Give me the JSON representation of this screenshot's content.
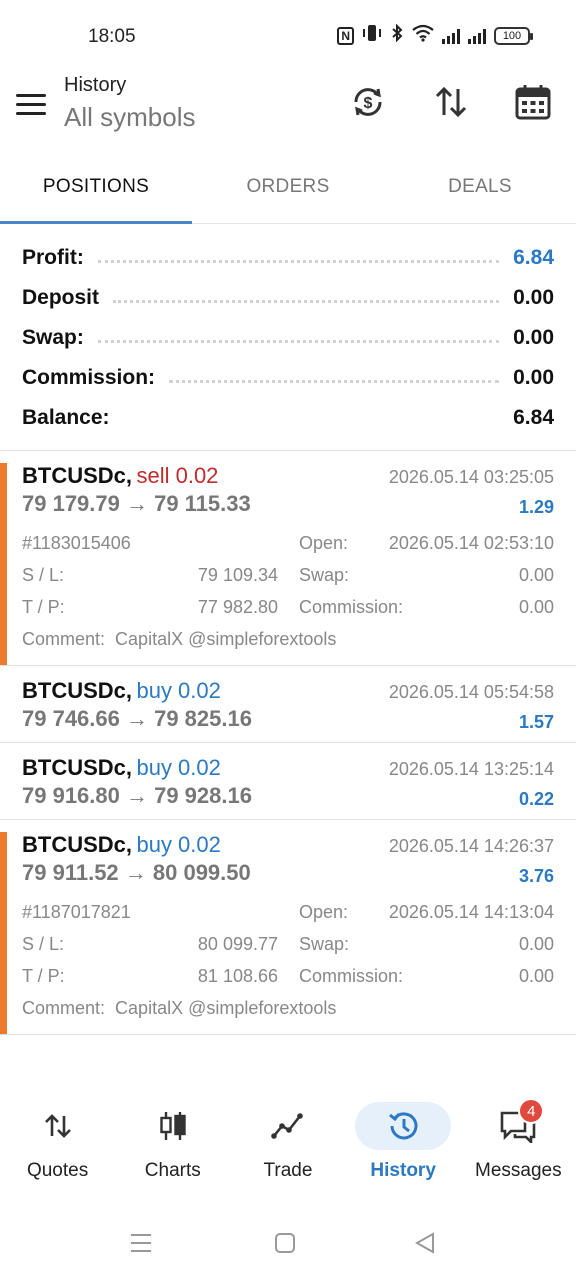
{
  "status_bar": {
    "time": "18:05",
    "battery": "100"
  },
  "header": {
    "title": "History",
    "subtitle": "All symbols"
  },
  "tabs": [
    {
      "label": "POSITIONS",
      "active": true
    },
    {
      "label": "ORDERS",
      "active": false
    },
    {
      "label": "DEALS",
      "active": false
    }
  ],
  "summary": [
    {
      "label": "Profit:",
      "value": "6.84",
      "highlight": true
    },
    {
      "label": "Deposit",
      "value": "0.00",
      "highlight": false
    },
    {
      "label": "Swap:",
      "value": "0.00",
      "highlight": false
    },
    {
      "label": "Commission:",
      "value": "0.00",
      "highlight": false
    },
    {
      "label": "Balance:",
      "value": "6.84",
      "highlight": false
    }
  ],
  "positions": [
    {
      "symbol": "BTCUSDc,",
      "side": "sell 0.02",
      "side_type": "sell",
      "close_time": "2026.05.14 03:25:05",
      "prices": "79 179.79 → 79 115.33",
      "profit": "1.29",
      "expanded": true,
      "ticket": "#1183015406",
      "open_label": "Open:",
      "open_time": "2026.05.14 02:53:10",
      "sl_label": "S / L:",
      "sl": "79 109.34",
      "swap_label": "Swap:",
      "swap": "0.00",
      "tp_label": "T / P:",
      "tp": "77 982.80",
      "commission_label": "Commission:",
      "commission": "0.00",
      "comment_label": "Comment:",
      "comment": "CapitalX @simpleforextools"
    },
    {
      "symbol": "BTCUSDc,",
      "side": "buy 0.02",
      "side_type": "buy",
      "close_time": "2026.05.14 05:54:58",
      "prices": "79 746.66 → 79 825.16",
      "profit": "1.57",
      "expanded": false
    },
    {
      "symbol": "BTCUSDc,",
      "side": "buy 0.02",
      "side_type": "buy",
      "close_time": "2026.05.14 13:25:14",
      "prices": "79 916.80 → 79 928.16",
      "profit": "0.22",
      "expanded": false
    },
    {
      "symbol": "BTCUSDc,",
      "side": "buy 0.02",
      "side_type": "buy",
      "close_time": "2026.05.14 14:26:37",
      "prices": "79 911.52 → 80 099.50",
      "profit": "3.76",
      "expanded": true,
      "ticket": "#1187017821",
      "open_label": "Open:",
      "open_time": "2026.05.14 14:13:04",
      "sl_label": "S / L:",
      "sl": "80 099.77",
      "swap_label": "Swap:",
      "swap": "0.00",
      "tp_label": "T / P:",
      "tp": "81 108.66",
      "commission_label": "Commission:",
      "commission": "0.00",
      "comment_label": "Comment:",
      "comment": "CapitalX @simpleforextools"
    }
  ],
  "bottom_nav": [
    {
      "label": "Quotes",
      "icon": "quotes-icon",
      "active": false
    },
    {
      "label": "Charts",
      "icon": "charts-icon",
      "active": false
    },
    {
      "label": "Trade",
      "icon": "trade-icon",
      "active": false
    },
    {
      "label": "History",
      "icon": "history-icon",
      "active": true
    },
    {
      "label": "Messages",
      "icon": "messages-icon",
      "active": false,
      "badge": "4"
    }
  ],
  "colors": {
    "accent": "#2a79c2",
    "sell": "#c12b2b",
    "marker": "#ec7a2c"
  }
}
